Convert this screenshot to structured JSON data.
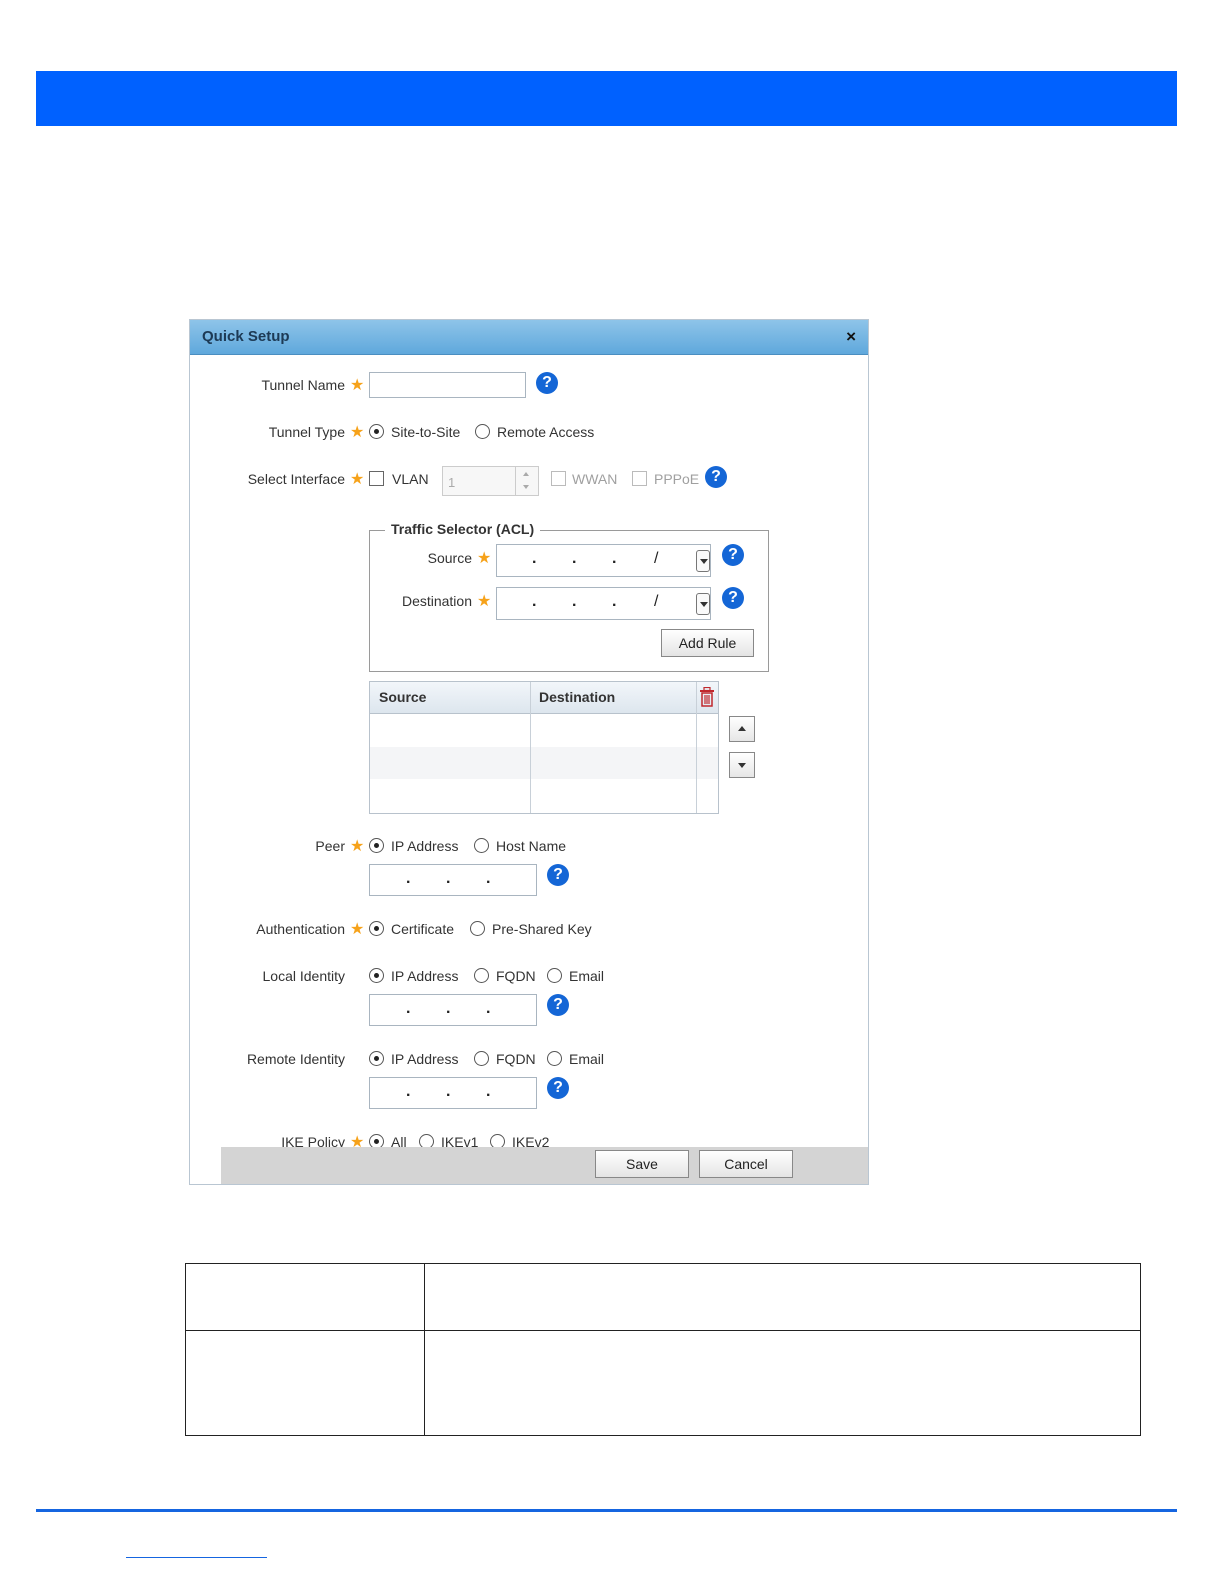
{
  "dialog": {
    "title": "Quick Setup",
    "close_glyph": "×",
    "help_glyph": "?",
    "tunnel_name": {
      "label": "Tunnel Name",
      "value": ""
    },
    "tunnel_type": {
      "label": "Tunnel Type",
      "options": [
        "Site-to-Site",
        "Remote Access"
      ],
      "selected": "Site-to-Site"
    },
    "select_interface": {
      "label": "Select Interface",
      "vlan_label": "VLAN",
      "vlan_value": "1",
      "wwan_label": "WWAN",
      "pppoe_label": "PPPoE"
    },
    "traffic_selector": {
      "legend": "Traffic Selector (ACL)",
      "source_label": "Source",
      "destination_label": "Destination",
      "add_rule_label": "Add Rule"
    },
    "rules_table": {
      "columns": [
        "Source",
        "Destination"
      ],
      "rows": []
    },
    "peer": {
      "label": "Peer",
      "options": [
        "IP Address",
        "Host Name"
      ],
      "selected": "IP Address"
    },
    "authentication": {
      "label": "Authentication",
      "options": [
        "Certificate",
        "Pre-Shared Key"
      ],
      "selected": "Certificate"
    },
    "local_identity": {
      "label": "Local Identity",
      "options": [
        "IP Address",
        "FQDN",
        "Email"
      ],
      "selected": "IP Address"
    },
    "remote_identity": {
      "label": "Remote Identity",
      "options": [
        "IP Address",
        "FQDN",
        "Email"
      ],
      "selected": "IP Address"
    },
    "ike_policy": {
      "label": "IKE Policy",
      "options": [
        "All",
        "IKEv1",
        "IKEv2"
      ],
      "selected": "All"
    },
    "save_label": "Save",
    "cancel_label": "Cancel"
  },
  "colors": {
    "banner": "#0061ff",
    "required_star": "#f6a21a",
    "help_icon": "#1466d6",
    "delete_icon": "#c0282d"
  },
  "icons": [
    "help-icon",
    "close-icon",
    "trash-icon",
    "up-arrow-icon",
    "down-arrow-icon",
    "dropdown-arrow-icon",
    "required-star-icon"
  ]
}
